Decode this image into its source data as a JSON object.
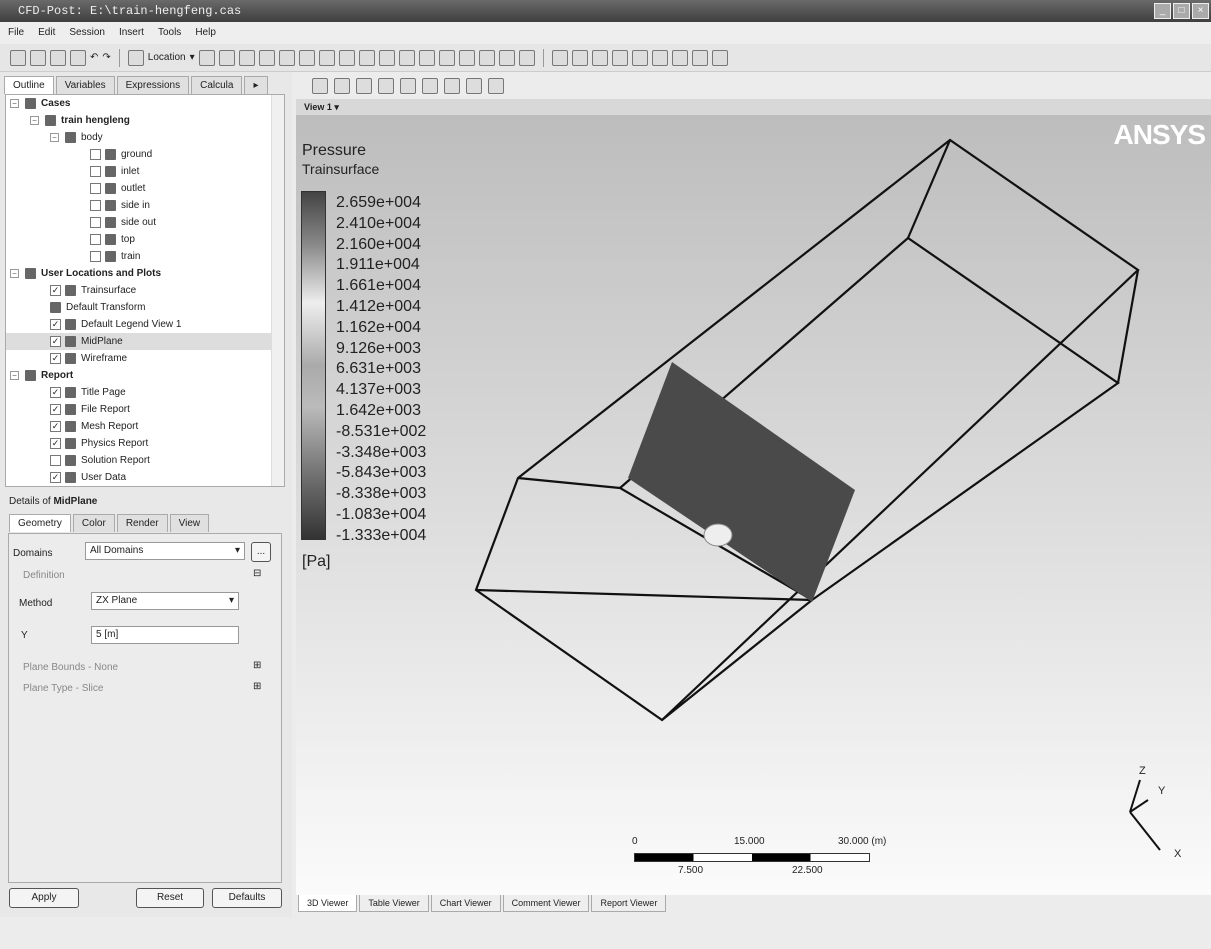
{
  "window": {
    "title": "CFD-Post: E:\\train-hengfeng.cas",
    "controls": [
      "_",
      "□",
      "×"
    ]
  },
  "menu": [
    "File",
    "Edit",
    "Session",
    "Insert",
    "Tools",
    "Help"
  ],
  "toolbar": {
    "location_label": "Location"
  },
  "left_tabs": [
    "Outline",
    "Variables",
    "Expressions",
    "Calcula"
  ],
  "tree": {
    "cases": "Cases",
    "case": "train hengleng",
    "body": "body",
    "regions": [
      "ground",
      "inlet",
      "outlet",
      "side in",
      "side out",
      "top",
      "train"
    ],
    "user_locations": "User Locations and Plots",
    "user_items": [
      {
        "label": "Trainsurface",
        "checked": true
      },
      {
        "label": "Default Transform",
        "checked": null
      },
      {
        "label": "Default Legend View 1",
        "checked": true
      },
      {
        "label": "MidPlane",
        "checked": true
      },
      {
        "label": "Wireframe",
        "checked": true
      }
    ],
    "report": "Report",
    "report_items": [
      {
        "label": "Title Page",
        "checked": true
      },
      {
        "label": "File Report",
        "checked": true
      },
      {
        "label": "Mesh Report",
        "checked": true
      },
      {
        "label": "Physics Report",
        "checked": true
      },
      {
        "label": "Solution Report",
        "checked": false
      },
      {
        "label": "User Data",
        "checked": true
      }
    ]
  },
  "details": {
    "title_prefix": "Details of",
    "title_object": "MidPlane",
    "tabs": [
      "Geometry",
      "Color",
      "Render",
      "View"
    ],
    "domains_label": "Domains",
    "domains_value": "All Domains",
    "more_button": "...",
    "definition_label": "Definition",
    "method_label": "Method",
    "method_value": "ZX Plane",
    "y_label": "Y",
    "y_value": "5 [m]",
    "plane_bounds": "Plane Bounds - None",
    "plane_type": "Plane Type - Slice",
    "apply": "Apply",
    "reset": "Reset",
    "defaults": "Defaults"
  },
  "viewer": {
    "view_label": "View 1 ▾",
    "brand": "ANSYS",
    "legend": {
      "title": "Pressure",
      "subtitle": "Trainsurface",
      "unit": "[Pa]",
      "values": [
        "2.659e+004",
        "2.410e+004",
        "2.160e+004",
        "1.911e+004",
        "1.661e+004",
        "1.412e+004",
        "1.162e+004",
        "9.126e+003",
        "6.631e+003",
        "4.137e+003",
        "1.642e+003",
        "-8.531e+002",
        "-3.348e+003",
        "-5.843e+003",
        "-8.338e+003",
        "-1.083e+004",
        "-1.333e+004"
      ]
    },
    "scale": {
      "top": [
        "0",
        "15.000",
        "30.000 (m)"
      ],
      "bottom": [
        "7.500",
        "22.500"
      ]
    },
    "axes": {
      "z": "Z",
      "y": "Y",
      "x": "X"
    },
    "tabs": [
      "3D Viewer",
      "Table Viewer",
      "Chart Viewer",
      "Comment Viewer",
      "Report Viewer"
    ]
  }
}
